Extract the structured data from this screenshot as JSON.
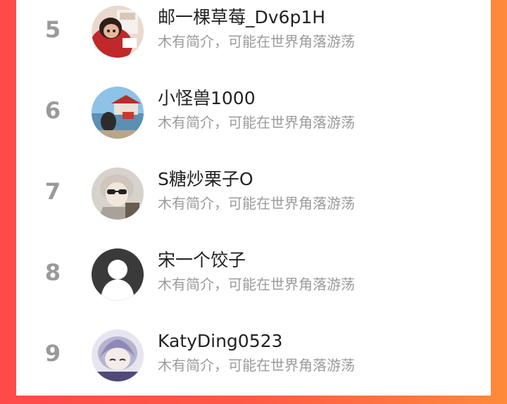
{
  "ranking": {
    "rows": [
      {
        "rank": "5",
        "name": "邮一棵草莓_Dv6p1H",
        "bio": "木有简介，可能在世界角落游荡",
        "avatar_icon": "cartoon-character-avatar"
      },
      {
        "rank": "6",
        "name": "小怪兽1000",
        "bio": "木有简介，可能在世界角落游荡",
        "avatar_icon": "lakeside-pavilion-avatar"
      },
      {
        "rank": "7",
        "name": "S糖炒栗子O",
        "bio": "木有简介，可能在世界角落游荡",
        "avatar_icon": "anime-boy-sunglasses-avatar"
      },
      {
        "rank": "8",
        "name": "宋一个饺子",
        "bio": "木有简介，可能在世界角落游荡",
        "avatar_icon": "default-person-avatar"
      },
      {
        "rank": "9",
        "name": "KatyDing0523",
        "bio": "木有简介，可能在世界角落游荡",
        "avatar_icon": "anime-girl-avatar"
      }
    ]
  },
  "colors": {
    "background_left": "#ff4a4a",
    "background_right": "#ff8a3a",
    "rank_color": "#9a9a9a",
    "name_color": "#222222",
    "bio_color": "#9b9b9b"
  }
}
